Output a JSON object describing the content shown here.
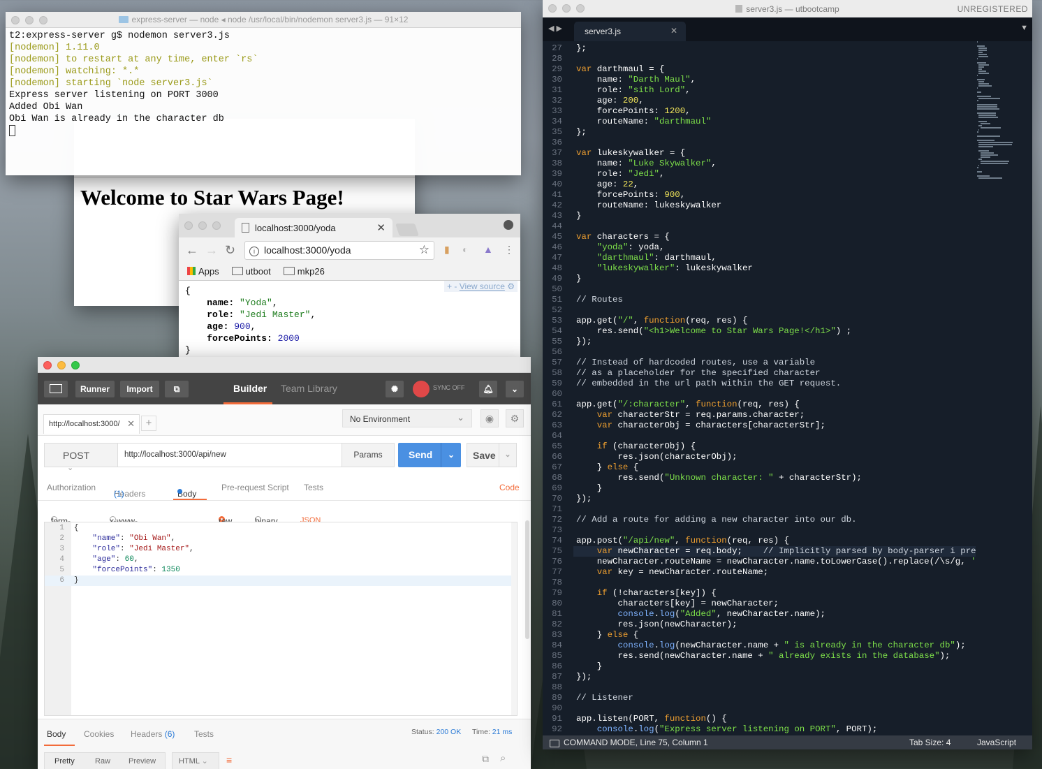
{
  "terminal": {
    "title": "express-server — node ◂ node /usr/local/bin/nodemon server3.js — 91×12",
    "lines": [
      {
        "text": "t2:express-server g$ nodemon server3.js",
        "style": "plain"
      },
      {
        "text": "[nodemon] 1.11.0",
        "style": "yellow"
      },
      {
        "text": "[nodemon] to restart at any time, enter `rs`",
        "style": "yellow"
      },
      {
        "text": "[nodemon] watching: *.*",
        "style": "yellow"
      },
      {
        "text": "[nodemon] starting `node server3.js`",
        "style": "yellow"
      },
      {
        "text": "Express server listening on PORT 3000",
        "style": "plain"
      },
      {
        "text": "Added Obi Wan",
        "style": "plain"
      },
      {
        "text": "Obi Wan is already in the character db",
        "style": "plain"
      }
    ]
  },
  "browser_back": {
    "heading": "Welcome to Star Wars Page!"
  },
  "chrome": {
    "tab_title": "localhost:3000/yoda",
    "address": "localhost:3000/yoda",
    "bookmarks": [
      "Apps",
      "utboot",
      "mkp26"
    ],
    "view_source": "View source",
    "json_lines": [
      {
        "key": "",
        "val": "{",
        "kind": "brace"
      },
      {
        "key": "name",
        "val": "\"Yoda\"",
        "kind": "s"
      },
      {
        "key": "role",
        "val": "\"Jedi Master\"",
        "kind": "s"
      },
      {
        "key": "age",
        "val": "900",
        "kind": "n"
      },
      {
        "key": "forcePoints",
        "val": "2000",
        "kind": "n"
      },
      {
        "key": "",
        "val": "}",
        "kind": "brace"
      }
    ]
  },
  "postman": {
    "toolbar": {
      "runner": "Runner",
      "import": "Import",
      "builder": "Builder",
      "team_library": "Team Library",
      "sync": "SYNC OFF"
    },
    "request_tab": "http://localhost:3000/",
    "environment": "No Environment",
    "method": "POST",
    "url": "http://localhost:3000/api/new",
    "params": "Params",
    "send": "Send",
    "save": "Save",
    "subtabs": {
      "authorization": "Authorization",
      "headers": "Headers",
      "headers_count": "(1)",
      "body": "Body",
      "prerequest": "Pre-request Script",
      "tests": "Tests",
      "code": "Code"
    },
    "body_options": {
      "form_data": "form-data",
      "urlencoded": "x-www-form-urlencoded",
      "raw": "raw",
      "binary": "binary",
      "content_type": "JSON (application/json)"
    },
    "editor_lines": [
      {
        "num": "1",
        "text": "{"
      },
      {
        "num": "2",
        "key": "\"name\"",
        "val": "\"Obi Wan\"",
        "kind": "s",
        "comma": ","
      },
      {
        "num": "3",
        "key": "\"role\"",
        "val": "\"Jedi Master\"",
        "kind": "s",
        "comma": ","
      },
      {
        "num": "4",
        "key": "\"age\"",
        "val": "60",
        "kind": "n",
        "comma": ","
      },
      {
        "num": "5",
        "key": "\"forcePoints\"",
        "val": "1350",
        "kind": "n",
        "comma": ""
      },
      {
        "num": "6",
        "text": "}"
      }
    ],
    "response": {
      "body": "Body",
      "cookies": "Cookies",
      "headers": "Headers",
      "headers_count": "(6)",
      "tests": "Tests",
      "status_label": "Status:",
      "status_value": "200 OK",
      "time_label": "Time:",
      "time_value": "21 ms",
      "pretty": "Pretty",
      "raw": "Raw",
      "preview": "Preview",
      "format": "HTML"
    }
  },
  "sublime": {
    "title": "server3.js — utbootcamp",
    "unregistered": "UNREGISTERED",
    "tab": "server3.js",
    "first_line_number": 27,
    "highlight_line": 75,
    "code_lines": [
      "};",
      "",
      "var darthmaul = {",
      "    name: \"Darth Maul\",",
      "    role: \"sith Lord\",",
      "    age: 200,",
      "    forcePoints: 1200,",
      "    routeName: \"darthmaul\"",
      "};",
      "",
      "var lukeskywalker = {",
      "    name: \"Luke Skywalker\",",
      "    role: \"Jedi\",",
      "    age: 22,",
      "    forcePoints: 900,",
      "    routeName: lukeskywalker",
      "}",
      "",
      "var characters = {",
      "    \"yoda\": yoda,",
      "    \"darthmaul\": darthmaul,",
      "    \"lukeskywalker\": lukeskywalker",
      "}",
      "",
      "// Routes",
      "",
      "app.get(\"/\", function(req, res) {",
      "    res.send(\"<h1>Welcome to Star Wars Page!</h1>\") ;",
      "});",
      "",
      "// Instead of hardcoded routes, use a variable",
      "// as a placeholder for the specified character",
      "// embedded in the url path within the GET request.",
      "",
      "app.get(\"/:character\", function(req, res) {",
      "    var characterStr = req.params.character;",
      "    var characterObj = characters[characterStr];",
      "",
      "    if (characterObj) {",
      "        res.json(characterObj);",
      "    } else {",
      "        res.send(\"Unknown character: \" + characterStr);",
      "    }",
      "});",
      "",
      "// Add a route for adding a new character into our db.",
      "",
      "app.post(\"/api/new\", function(req, res) {",
      "    var newCharacter = req.body;    // Implicitly parsed by body-parser i presume.",
      "    newCharacter.routeName = newCharacter.name.toLowerCase().replace(/\\s/g, '');",
      "    var key = newCharacter.routeName;",
      "",
      "    if (!characters[key]) {",
      "        characters[key] = newCharacter;",
      "        console.log(\"Added\", newCharacter.name);",
      "        res.json(newCharacter);",
      "    } else {",
      "        console.log(newCharacter.name + \" is already in the character db\");",
      "        res.send(newCharacter.name + \" already exists in the database\");",
      "    }",
      "});",
      "",
      "// Listener",
      "",
      "app.listen(PORT, function() {",
      "    console.log(\"Express server listening on PORT\", PORT);"
    ],
    "status_mode": "COMMAND MODE, Line 75, Column 1",
    "status_tab": "Tab Size: 4",
    "status_syntax": "JavaScript"
  }
}
